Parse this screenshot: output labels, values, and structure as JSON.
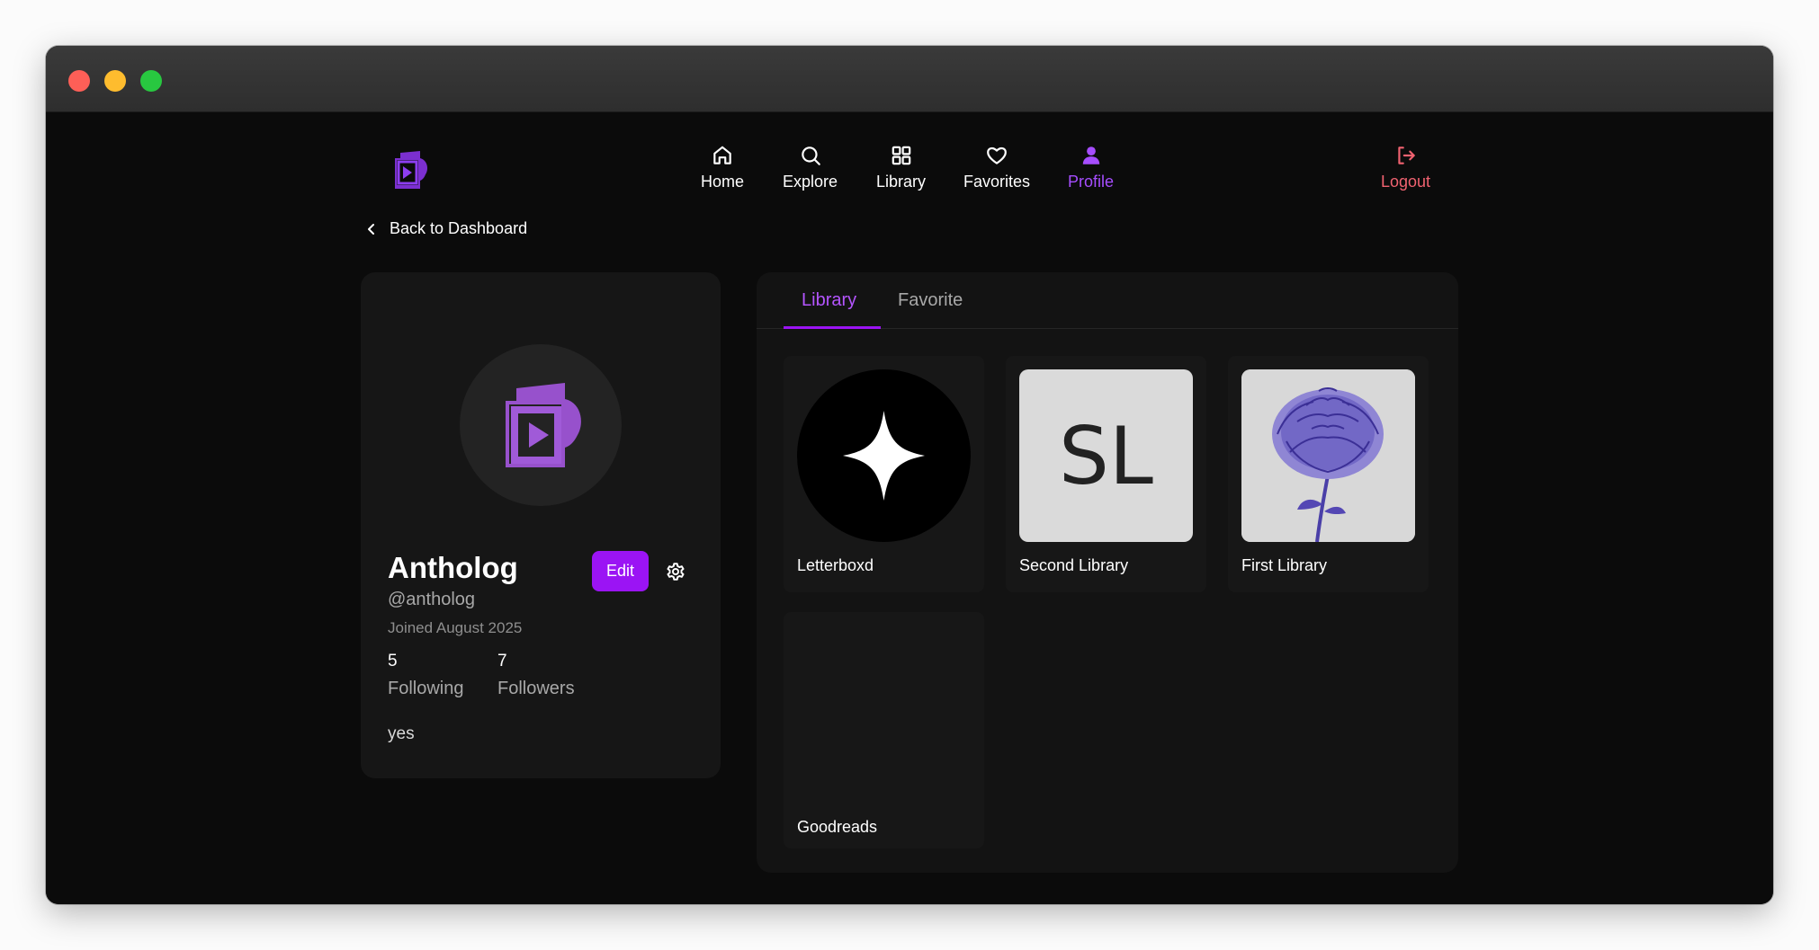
{
  "window": {
    "controls": [
      "close",
      "minimize",
      "maximize"
    ]
  },
  "nav": {
    "items": [
      {
        "label": "Home",
        "icon": "home-icon"
      },
      {
        "label": "Explore",
        "icon": "search-icon"
      },
      {
        "label": "Library",
        "icon": "grid-icon"
      },
      {
        "label": "Favorites",
        "icon": "heart-icon"
      },
      {
        "label": "Profile",
        "icon": "user-icon",
        "active": true
      }
    ],
    "logout": {
      "label": "Logout",
      "icon": "logout-icon"
    }
  },
  "back": {
    "label": "Back to Dashboard"
  },
  "profile": {
    "name": "Antholog",
    "handle": "@antholog",
    "joined": "Joined August 2025",
    "edit_label": "Edit",
    "following": {
      "count": "5",
      "label": "Following"
    },
    "followers": {
      "count": "7",
      "label": "Followers"
    },
    "bio": "yes"
  },
  "tabs": [
    {
      "label": "Library",
      "active": true
    },
    {
      "label": "Favorite",
      "active": false
    }
  ],
  "libraries": [
    {
      "name": "Letterboxd",
      "thumb": "sparkle-icon"
    },
    {
      "name": "Second Library",
      "thumb_text": "SL"
    },
    {
      "name": "First Library",
      "thumb": "flower-image"
    },
    {
      "name": "Goodreads",
      "thumb": ""
    }
  ],
  "colors": {
    "accent": "#9b14f4",
    "accent_text": "#a64dff",
    "logout": "#f06270",
    "background": "#0b0b0b",
    "card": "#161616"
  }
}
